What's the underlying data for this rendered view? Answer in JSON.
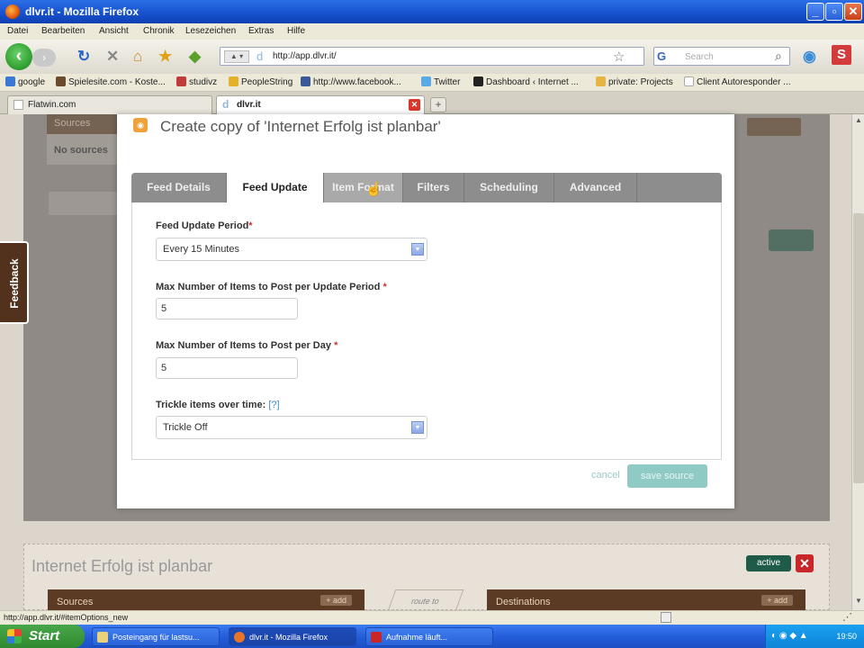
{
  "window": {
    "title": "dlvr.it - Mozilla Firefox"
  },
  "menu": [
    "Datei",
    "Bearbeiten",
    "Ansicht",
    "Chronik",
    "Lesezeichen",
    "Extras",
    "Hilfe"
  ],
  "nav": {
    "url": "http://app.dlvr.it/",
    "search_placeholder": "Search"
  },
  "bookmarks": [
    "google",
    "Spielesite.com - Koste...",
    "studivz",
    "PeopleString",
    "http://www.facebook...",
    "Twitter",
    "Dashboard ‹ Internet ...",
    "private: Projects",
    "Client Autoresponder ..."
  ],
  "tabs": [
    {
      "label": "Flatwin.com"
    },
    {
      "label": "dlvr.it"
    }
  ],
  "page": {
    "sources_label": "Sources",
    "no_sources": "No sources",
    "bottom_title": "Internet Erfolg ist planbar",
    "active_badge": "active",
    "sources2": "Sources",
    "destinations": "Destinations",
    "add": "+ add",
    "route_to": "route to"
  },
  "feedback": "Feedback",
  "modal": {
    "title": "Create copy of 'Internet Erfolg ist planbar'",
    "tabs": [
      "Feed Details",
      "Feed Update",
      "Item Format",
      "Filters",
      "Scheduling",
      "Advanced"
    ],
    "fields": {
      "period_label": "Feed Update Period",
      "period_value": "Every 15 Minutes",
      "max_period_label": "Max Number of Items to Post per Update Period",
      "max_period_value": "5",
      "max_day_label": "Max Number of Items to Post per Day",
      "max_day_value": "5",
      "trickle_label": "Trickle items over time:",
      "trickle_help": "[?]",
      "trickle_value": "Trickle Off"
    },
    "cancel": "cancel",
    "save": "save source"
  },
  "status": "http://app.dlvr.it/#itemOptions_new",
  "taskbar": {
    "start": "Start",
    "items": [
      "Posteingang für lastsu...",
      "dlvr.it - Mozilla Firefox",
      "Aufnahme läuft..."
    ],
    "clock": "19:50"
  }
}
